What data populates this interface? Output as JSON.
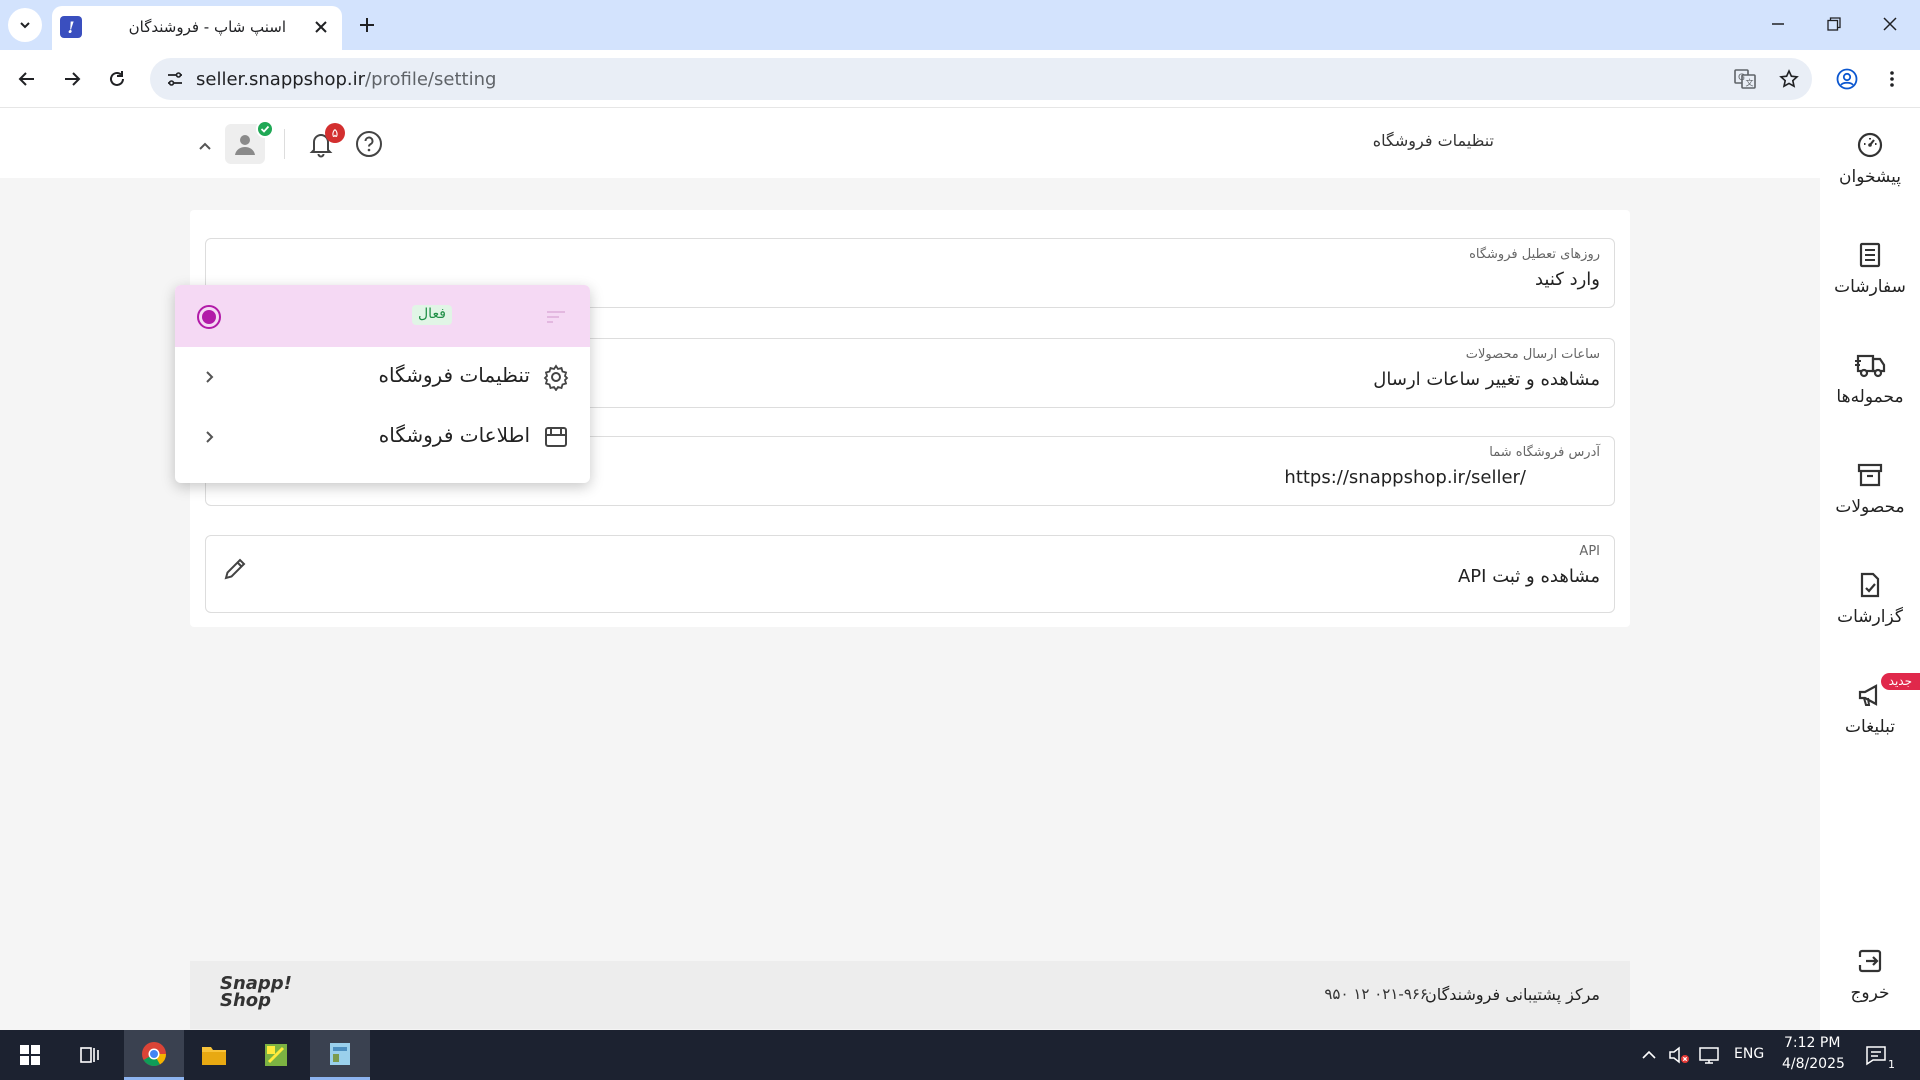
{
  "browser": {
    "tab_title": "اسنپ شاپ - فروشندگان",
    "url_host": "seller.snappshop.ir",
    "url_path": "/profile/setting"
  },
  "header": {
    "page_title": "تنظیمات فروشگاه",
    "notification_count": "۵"
  },
  "sidebar": {
    "items": [
      {
        "label": "پیشخوان",
        "icon": "dashboard-icon"
      },
      {
        "label": "سفارشات",
        "icon": "orders-icon"
      },
      {
        "label": "محموله‌ها",
        "icon": "truck-icon"
      },
      {
        "label": "محصولات",
        "icon": "archive-box-icon"
      },
      {
        "label": "گزارشات",
        "icon": "report-icon"
      },
      {
        "label": "تبلیغات",
        "icon": "megaphone-icon",
        "badge": "جدید"
      }
    ],
    "logout_label": "خروج"
  },
  "dropdown": {
    "status_label": "فعال",
    "items": [
      {
        "label": "تنظیمات فروشگاه",
        "icon": "gear-icon"
      },
      {
        "label": "اطلاعات فروشگاه",
        "icon": "store-icon"
      }
    ]
  },
  "settings": {
    "fields": [
      {
        "label": "روزهای تعطیل فروشگاه",
        "value": "وارد کنید"
      },
      {
        "label": "ساعات ارسال محصولات",
        "value": "مشاهده و تغییر ساعات ارسال"
      },
      {
        "label": "آدرس فروشگاه شما",
        "value": "https://snappshop.ir/seller/"
      },
      {
        "label": "API",
        "value": "مشاهده و ثبت API"
      }
    ]
  },
  "footer": {
    "support_label": "مرکز پشتیبانی فروشندگان",
    "support_phone": "۰۲۱-۹۶۶ ۱۲ ۹۵۰",
    "logo_line1": "Snapp!",
    "logo_line2": "Shop"
  },
  "taskbar": {
    "language": "ENG",
    "time": "7:12 PM",
    "date": "4/8/2025",
    "notification_count": "1"
  },
  "colors": {
    "accent": "#b21aa8",
    "status_bg": "#f5d9f4",
    "active_green": "#1f8f46",
    "badge_red": "#d32f2f"
  }
}
